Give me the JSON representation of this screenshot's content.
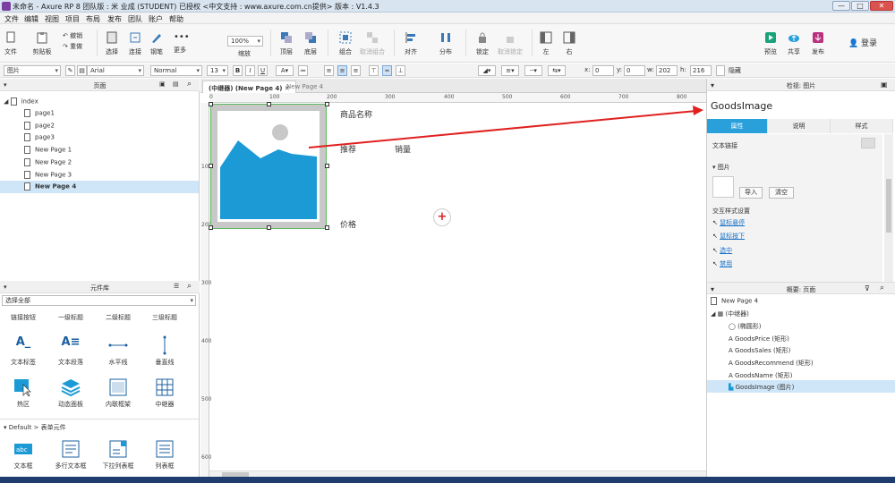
{
  "window": {
    "title": "未命名 - Axure RP 8 团队版 : 米 业成 (STUDENT) 已授权      <中文支持 : www.axure.com.cn提供> 版本 : V1.4.3",
    "controls": [
      "—",
      "□",
      "✕"
    ]
  },
  "menu": [
    "文件",
    "编辑",
    "视图",
    "项目",
    "布局",
    "发布",
    "团队",
    "账户",
    "帮助"
  ],
  "toolbar": {
    "file": "文件",
    "clipboard": "剪贴板",
    "undo": "撤销",
    "redo": "重做",
    "select": "选择",
    "connect": "连接",
    "pen": "钢笔",
    "more": "更多",
    "zoom_value": "100%",
    "zoom_label": "缩放",
    "top_layer": "顶层",
    "bottom_layer": "底层",
    "group": "组合",
    "ungroup": "取消组合",
    "align": "对齐",
    "distribute": "分布",
    "lock": "锁定",
    "unlock": "取消锁定",
    "left": "左",
    "right": "右",
    "preview": "预览",
    "share": "共享",
    "publish": "发布",
    "login": "登录"
  },
  "format": {
    "style": "图片",
    "font": "Arial",
    "weight": "Normal",
    "size": "13",
    "x_label": "x:",
    "x_value": "0",
    "y_label": "y:",
    "y_value": "0",
    "w_label": "w:",
    "w_value": "202",
    "h_label": "h:",
    "h_value": "216",
    "hidden_label": "隐藏"
  },
  "pages_panel": {
    "title": "页面",
    "root": "index",
    "pages": [
      "page1",
      "page2",
      "page3",
      "New Page 1",
      "New Page 2",
      "New Page 3",
      "New Page 4"
    ],
    "selected": "New Page 4"
  },
  "library_panel": {
    "title": "元件库",
    "filter": "选择全部",
    "headings": [
      "链接按钮",
      "一级标题",
      "二级标题",
      "三级标题"
    ],
    "row1": [
      "文本标签",
      "文本段落",
      "水平线",
      "垂直线"
    ],
    "row2": [
      "热区",
      "动态面板",
      "内联框架",
      "中继器"
    ],
    "section": "Default > 表单元件",
    "row3": [
      "文本框",
      "多行文本框",
      "下拉列表框",
      "列表框"
    ]
  },
  "canvas": {
    "tabs": [
      "(中继器) (New Page 4)",
      "New Page 4"
    ],
    "ruler_h": [
      "0",
      "100",
      "200",
      "300",
      "400",
      "500",
      "600",
      "700",
      "800"
    ],
    "ruler_v": [
      "100",
      "200",
      "300",
      "400",
      "500",
      "600"
    ],
    "labels": {
      "name": "商品名称",
      "recommend": "推荐",
      "sales": "销量",
      "price": "价格"
    },
    "add_symbol": "+"
  },
  "inspector": {
    "header": "检视: 图片",
    "widget_name": "GoodsImage",
    "tabs": [
      "属性",
      "说明",
      "样式"
    ],
    "active_tab": "属性",
    "text_link": "文本链接",
    "image_section": "图片",
    "import": "导入",
    "clear": "清空",
    "interaction_title": "交互样式设置",
    "interactions": [
      "鼠标悬停",
      "鼠标按下",
      "选中",
      "禁用"
    ]
  },
  "outline": {
    "title": "概要: 页面",
    "page": "New Page 4",
    "repeater": "(中继器)",
    "items": [
      "(椭圆形)",
      "GoodsPrice (矩形)",
      "GoodsSales (矩形)",
      "GoodsRecommend (矩形)",
      "GoodsName (矩形)",
      "GoodsImage (图片)"
    ],
    "selected": "GoodsImage (图片)"
  },
  "colors": {
    "accent": "#2aa0db",
    "image_blue": "#1b9ad6",
    "arrow_red": "#e02020",
    "selection_bg": "#cfe6f8"
  }
}
